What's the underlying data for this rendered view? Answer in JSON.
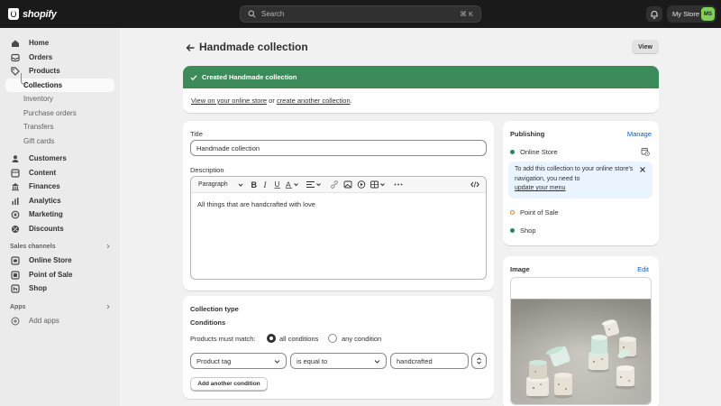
{
  "topbar": {
    "brand": "shopify",
    "search_placeholder": "Search",
    "search_shortcut": "⌘ K",
    "store_name": "My Store",
    "avatar_initials": "MS"
  },
  "sidebar": {
    "items": [
      {
        "label": "Home"
      },
      {
        "label": "Orders"
      },
      {
        "label": "Products"
      },
      {
        "label": "Collections"
      },
      {
        "label": "Inventory"
      },
      {
        "label": "Purchase orders"
      },
      {
        "label": "Transfers"
      },
      {
        "label": "Gift cards"
      },
      {
        "label": "Customers"
      },
      {
        "label": "Content"
      },
      {
        "label": "Finances"
      },
      {
        "label": "Analytics"
      },
      {
        "label": "Marketing"
      },
      {
        "label": "Discounts"
      }
    ],
    "sales_channels_label": "Sales channels",
    "channels": [
      {
        "label": "Online Store"
      },
      {
        "label": "Point of Sale"
      },
      {
        "label": "Shop"
      }
    ],
    "apps_label": "Apps",
    "add_apps_label": "Add apps"
  },
  "page": {
    "title": "Handmade collection",
    "view_label": "View"
  },
  "banner": {
    "heading": "Created Handmade collection",
    "link1": "View on your online store",
    "or": " or ",
    "link2": "create another collection",
    "period": "."
  },
  "details": {
    "title_label": "Title",
    "title_value": "Handmade collection",
    "description_label": "Description",
    "paragraph_label": "Paragraph",
    "description_text": "All things that are handcrafted with love"
  },
  "collection_type": {
    "heading": "Collection type",
    "conditions_label": "Conditions",
    "match_label": "Products must match:",
    "all_conditions": "all conditions",
    "any_condition": "any condition",
    "field": "Product tag",
    "operator": "is equal to",
    "value": "handcrafted",
    "add_condition": "Add another condition"
  },
  "publishing": {
    "heading": "Publishing",
    "manage": "Manage",
    "channels": [
      {
        "label": "Online Store",
        "status_color": "#29845a"
      },
      {
        "label": "Point of Sale",
        "status_color": "#e67e22"
      },
      {
        "label": "Shop",
        "status_color": "#29845a"
      }
    ],
    "info_text": "To add this collection to your online store's navigation, you need to",
    "info_link": "update your menu"
  },
  "image": {
    "heading": "Image",
    "edit": "Edit"
  },
  "colors": {
    "accent_link": "#005bd3",
    "success_banner": "#3d8b5a",
    "topbar": "#1a1a1a"
  }
}
